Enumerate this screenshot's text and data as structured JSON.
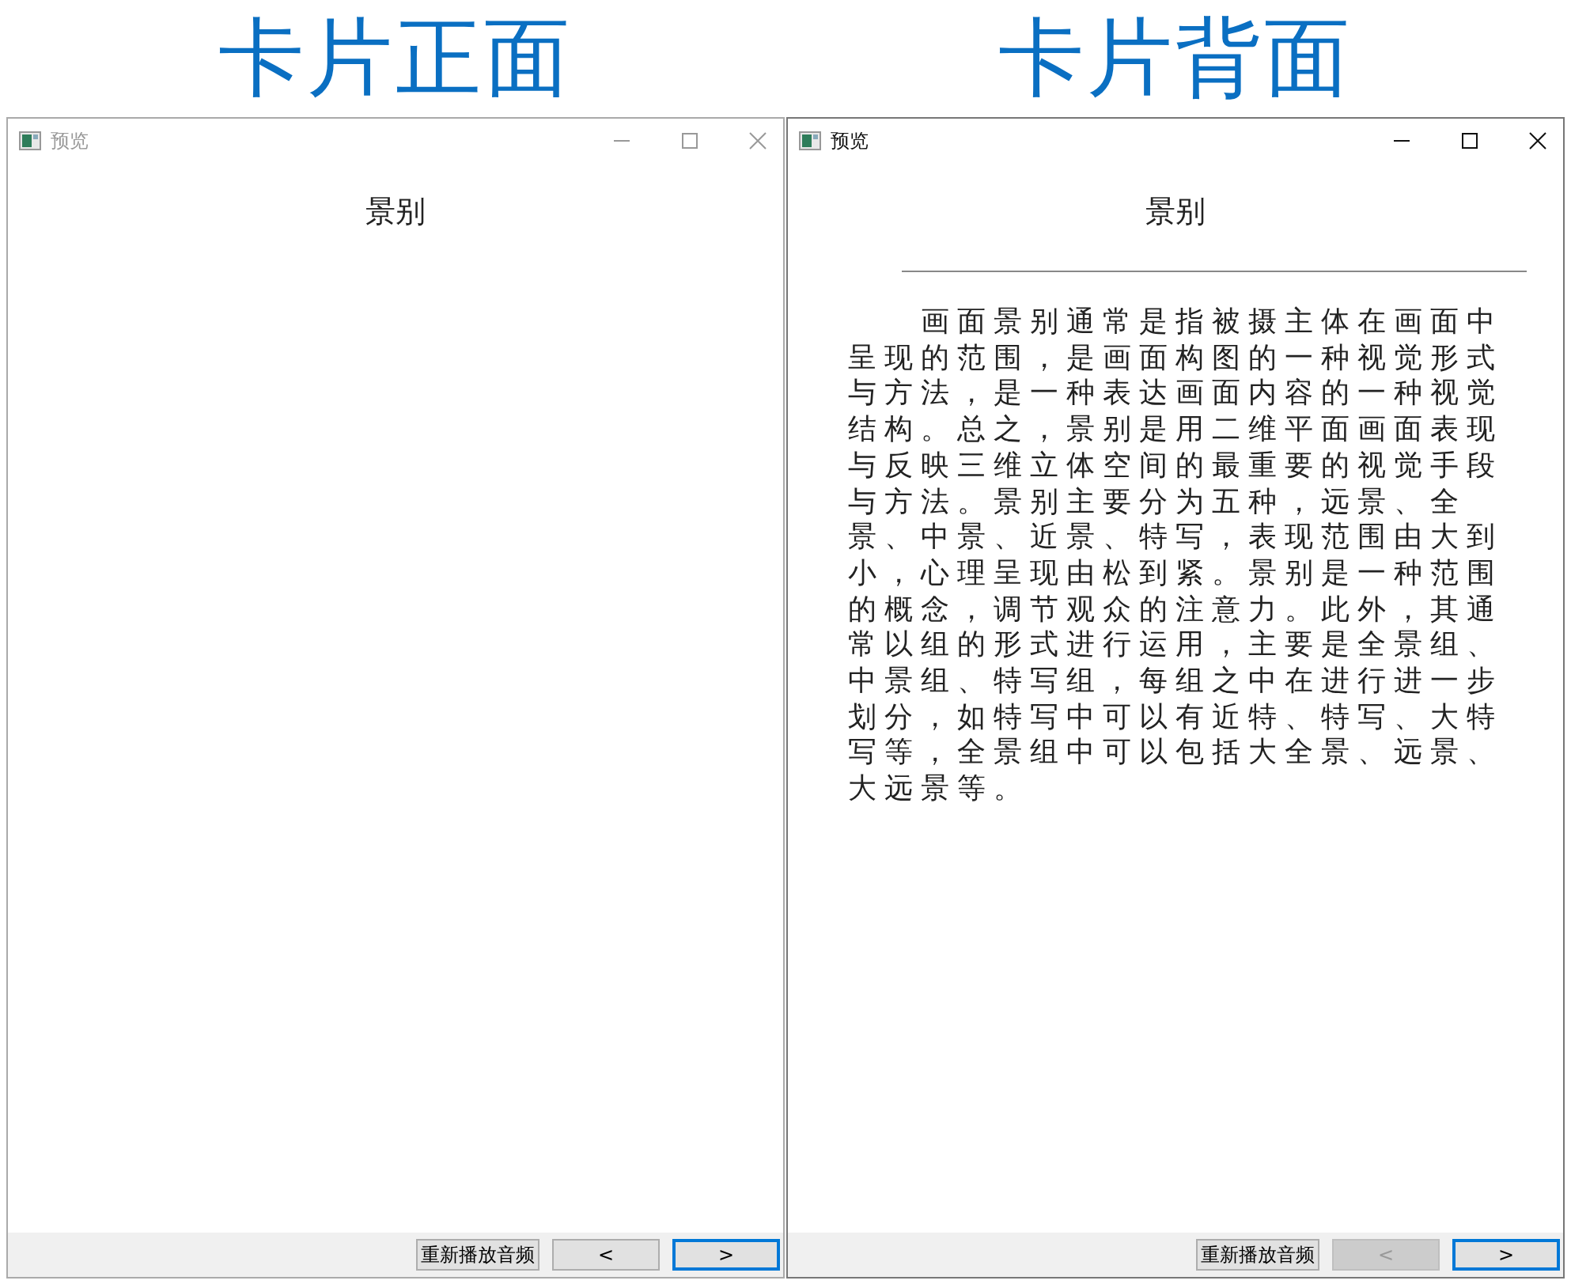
{
  "panels": [
    {
      "caption": "卡片正面",
      "window": {
        "title": "预览",
        "active": false
      },
      "heading": "景别",
      "buttons": {
        "replay": "重新播放音频",
        "prev": {
          "label": "<",
          "disabled": false,
          "focused": false
        },
        "next": {
          "label": ">",
          "disabled": false,
          "focused": true
        }
      }
    },
    {
      "caption": "卡片背面",
      "window": {
        "title": "预览",
        "active": true
      },
      "heading": "景别",
      "body": "画面景别通常是指被摄主体在画面中呈现的范围，是画面构图的一种视觉形式与方法，是一种表达画面内容的一种视觉结构。总之，景别是用二维平面画面表现与反映三维立体空间的最重要的视觉手段与方法。景别主要分为五种，远景、全景、中景、近景、特写，表现范围由大到小，心理呈现由松到紧。景别是一种范围的概念，调节观众的注意力。此外，其通常以组的形式进行运用，主要是全景组、中景组、特写组，每组之中在进行进一步划分，如特写中可以有近特、特写、大特写等，全景组中可以包括大全景、远景、大远景等。",
      "buttons": {
        "replay": "重新播放音频",
        "prev": {
          "label": "<",
          "disabled": true,
          "focused": false
        },
        "next": {
          "label": ">",
          "disabled": false,
          "focused": true
        }
      }
    }
  ]
}
